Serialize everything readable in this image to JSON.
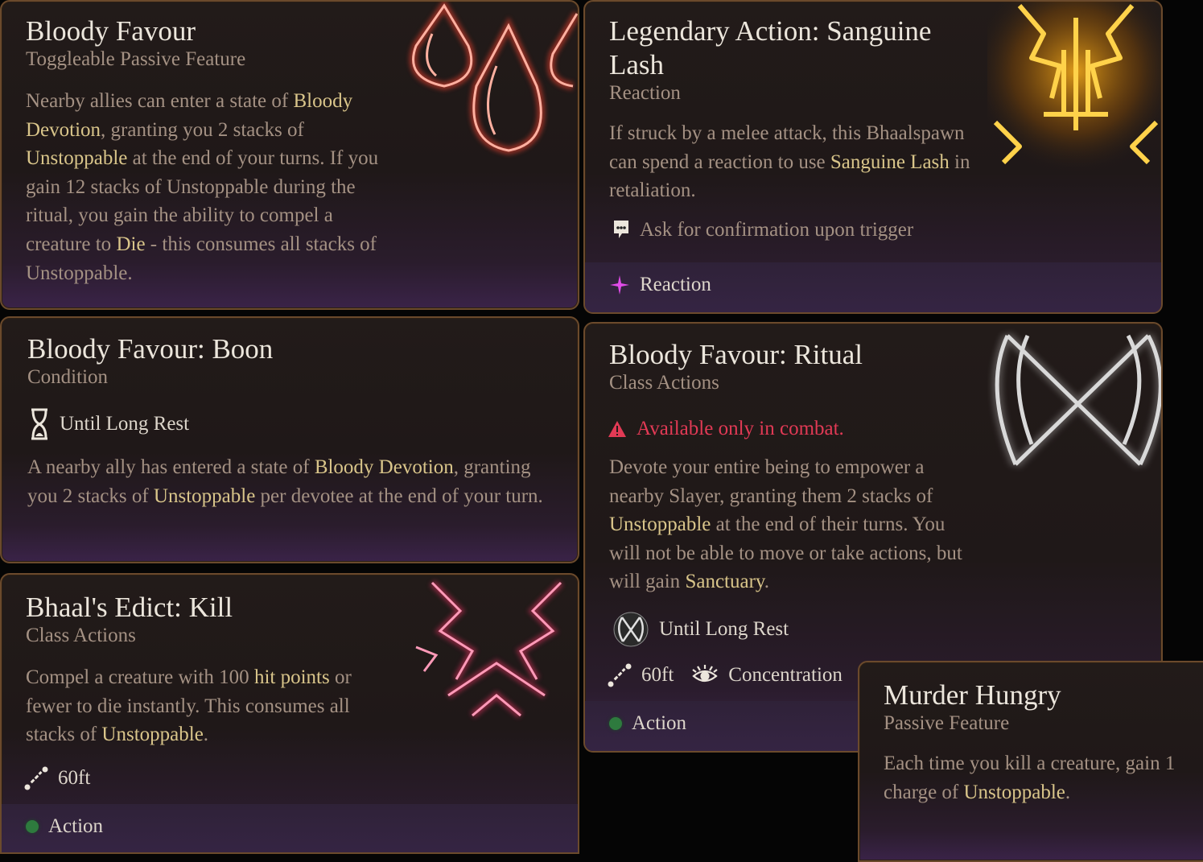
{
  "cards": {
    "bloody_favour": {
      "title": "Bloody Favour",
      "subtitle": "Toggleable Passive Feature",
      "desc": [
        {
          "t": "Nearby allies can enter a state of "
        },
        {
          "t": "Bloody Devotion",
          "hl": true
        },
        {
          "t": ", granting you 2 stacks of "
        },
        {
          "t": "Unstoppable",
          "hl": true
        },
        {
          "t": " at the end of your turns. If you gain 12 stacks of Unstoppable during the ritual, you gain the ability to compel a creature to "
        },
        {
          "t": "Die",
          "hl": true
        },
        {
          "t": " - this consumes all stacks of Unstoppable."
        }
      ],
      "icon": "blood-drops-icon"
    },
    "legendary_action": {
      "title": "Legendary Action: Sanguine Lash",
      "subtitle": "Reaction",
      "desc": [
        {
          "t": "If struck by a melee attack, this Bhaalspawn can spend a reaction to use "
        },
        {
          "t": "Sanguine Lash",
          "hl": true
        },
        {
          "t": " in retaliation."
        }
      ],
      "prompt_label": "Ask for confirmation upon trigger",
      "footer_label": "Reaction",
      "icon": "sanguine-lash-icon"
    },
    "boon": {
      "title": "Bloody Favour: Boon",
      "subtitle": "Condition",
      "duration_label": "Until Long Rest",
      "desc": [
        {
          "t": "A nearby ally has entered a state of "
        },
        {
          "t": "Bloody Devotion",
          "hl": true
        },
        {
          "t": ", granting you 2 stacks of "
        },
        {
          "t": "Unstoppable",
          "hl": true
        },
        {
          "t": " per devotee at the end of your turn."
        }
      ]
    },
    "ritual": {
      "title": "Bloody Favour: Ritual",
      "subtitle": "Class Actions",
      "warning": "Available only in combat.",
      "desc": [
        {
          "t": "Devote your entire being to empower a nearby Slayer, granting them 2 stacks of "
        },
        {
          "t": "Unstoppable",
          "hl": true
        },
        {
          "t": " at the end of their turns. You will not be able to move or take actions, but will gain "
        },
        {
          "t": "Sanctuary",
          "hl": true
        },
        {
          "t": "."
        }
      ],
      "duration_label": "Until Long Rest",
      "range_label": "60ft",
      "concentration_label": "Concentration",
      "footer_label": "Action",
      "icon": "crossed-scythes-icon"
    },
    "edict_kill": {
      "title": "Bhaal's Edict: Kill",
      "subtitle": "Class Actions",
      "desc": [
        {
          "t": "Compel a creature with 100 "
        },
        {
          "t": "hit points",
          "hl": true
        },
        {
          "t": " or fewer to die instantly. This consumes all stacks of "
        },
        {
          "t": "Unstoppable",
          "hl": true
        },
        {
          "t": "."
        }
      ],
      "range_label": "60ft",
      "footer_label": "Action",
      "icon": "bhaal-skull-icon"
    },
    "murder_hungry": {
      "title": "Murder Hungry",
      "subtitle": "Passive Feature",
      "desc": [
        {
          "t": "Each time you kill a creature, gain 1 charge of "
        },
        {
          "t": "Unstoppable",
          "hl": true
        },
        {
          "t": "."
        }
      ]
    }
  },
  "colors": {
    "title": "#ece6dc",
    "body": "#a49183",
    "highlight": "#d9c58a",
    "warning": "#e23a55",
    "action_dot": "#2e7a3e",
    "reaction_star": "#e04ce8",
    "border": "#6b4a2c"
  }
}
